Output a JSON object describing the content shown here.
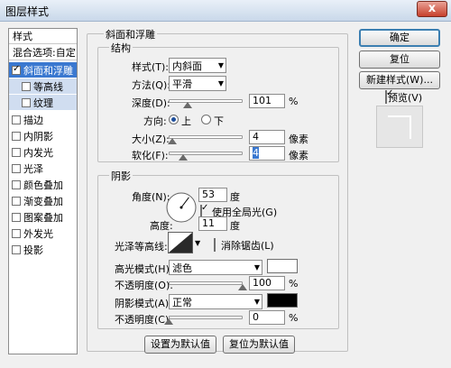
{
  "window": {
    "title": "图层样式",
    "close_symbol": "x"
  },
  "left_panel": {
    "header": "样式",
    "blend_options": "混合选项:自定",
    "items": [
      {
        "label": "斜面和浮雕",
        "checked": true,
        "selected": true
      },
      {
        "label": "等高线",
        "checked": false,
        "sub": true
      },
      {
        "label": "纹理",
        "checked": false,
        "sub": true
      },
      {
        "label": "描边",
        "checked": false
      },
      {
        "label": "内阴影",
        "checked": false
      },
      {
        "label": "内发光",
        "checked": false
      },
      {
        "label": "光泽",
        "checked": false
      },
      {
        "label": "颜色叠加",
        "checked": false
      },
      {
        "label": "渐变叠加",
        "checked": false
      },
      {
        "label": "图案叠加",
        "checked": false
      },
      {
        "label": "外发光",
        "checked": false
      },
      {
        "label": "投影",
        "checked": false
      }
    ]
  },
  "bevel": {
    "section_title": "斜面和浮雕",
    "structure": {
      "title": "结构",
      "style_label": "样式(T):",
      "style_value": "内斜面",
      "technique_label": "方法(Q):",
      "technique_value": "平滑",
      "depth_label": "深度(D):",
      "depth_value": "101",
      "depth_pct": 0.25,
      "depth_unit": "%",
      "direction_label": "方向:",
      "direction_up": "上",
      "direction_down": "下",
      "size_label": "大小(Z):",
      "size_value": "4",
      "size_pct": 0.05,
      "size_unit": "像素",
      "soften_label": "软化(F):",
      "soften_value": "4",
      "soften_pct": 0.2,
      "soften_unit": "像素"
    },
    "shading": {
      "title": "阴影",
      "angle_label": "角度(N):",
      "angle_value": "53",
      "angle_unit": "度",
      "global_light_label": "使用全局光(G)",
      "global_light_checked": true,
      "altitude_label": "高度:",
      "altitude_value": "11",
      "altitude_unit": "度",
      "gloss_label": "光泽等高线:",
      "antialias_label": "消除锯齿(L)",
      "antialias_checked": false,
      "highlight_mode_label": "高光模式(H):",
      "highlight_mode_value": "滤色",
      "highlight_color": "#ffffff",
      "highlight_opacity_label": "不透明度(O):",
      "highlight_opacity_value": "100",
      "highlight_opacity_pct": 1.0,
      "highlight_opacity_unit": "%",
      "shadow_mode_label": "阴影模式(A):",
      "shadow_mode_value": "正常",
      "shadow_color": "#000000",
      "shadow_opacity_label": "不透明度(C):",
      "shadow_opacity_value": "0",
      "shadow_opacity_pct": 0.0,
      "shadow_opacity_unit": "%"
    },
    "make_default": "设置为默认值",
    "reset_default": "复位为默认值"
  },
  "actions": {
    "ok": "确定",
    "reset": "复位",
    "new_style": "新建样式(W)...",
    "preview_label": "预览(V)",
    "preview_checked": true
  },
  "colors": {
    "accent": "#3a78d0",
    "window": "#f0f0f0"
  }
}
